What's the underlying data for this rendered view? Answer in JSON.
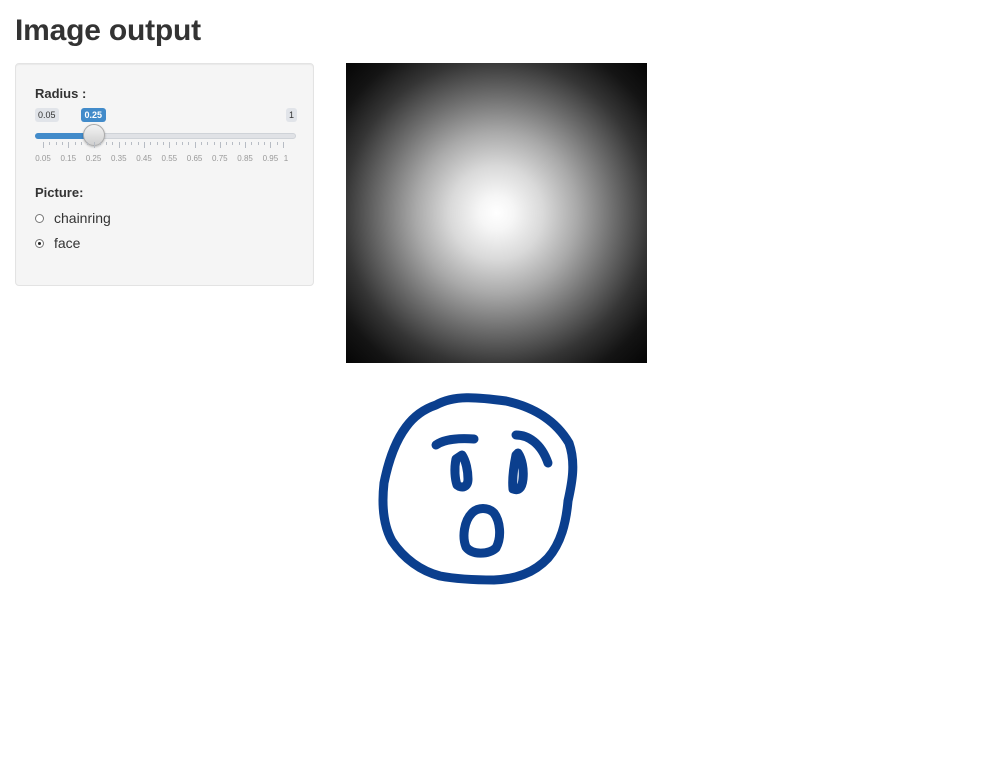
{
  "page": {
    "title": "Image output"
  },
  "sidebar": {
    "radius": {
      "label": "Radius :",
      "min_label": "0.05",
      "max_label": "1",
      "min": 0.05,
      "max": 1,
      "value": 0.25,
      "value_label": "0.25",
      "tick_labels": [
        "0.05",
        "0.15",
        "0.25",
        "0.35",
        "0.45",
        "0.55",
        "0.65",
        "0.75",
        "0.85",
        "0.95",
        "1"
      ],
      "accent_color": "#428bca"
    },
    "picture": {
      "label": "Picture:",
      "options": [
        {
          "label": "chainring",
          "checked": false
        },
        {
          "label": "face",
          "checked": true
        }
      ]
    }
  },
  "outputs": {
    "gradient_image": {
      "icon": "radial-gradient-image"
    },
    "face_image": {
      "icon": "surprised-face-drawing",
      "stroke_color": "#0b3f8e"
    }
  }
}
